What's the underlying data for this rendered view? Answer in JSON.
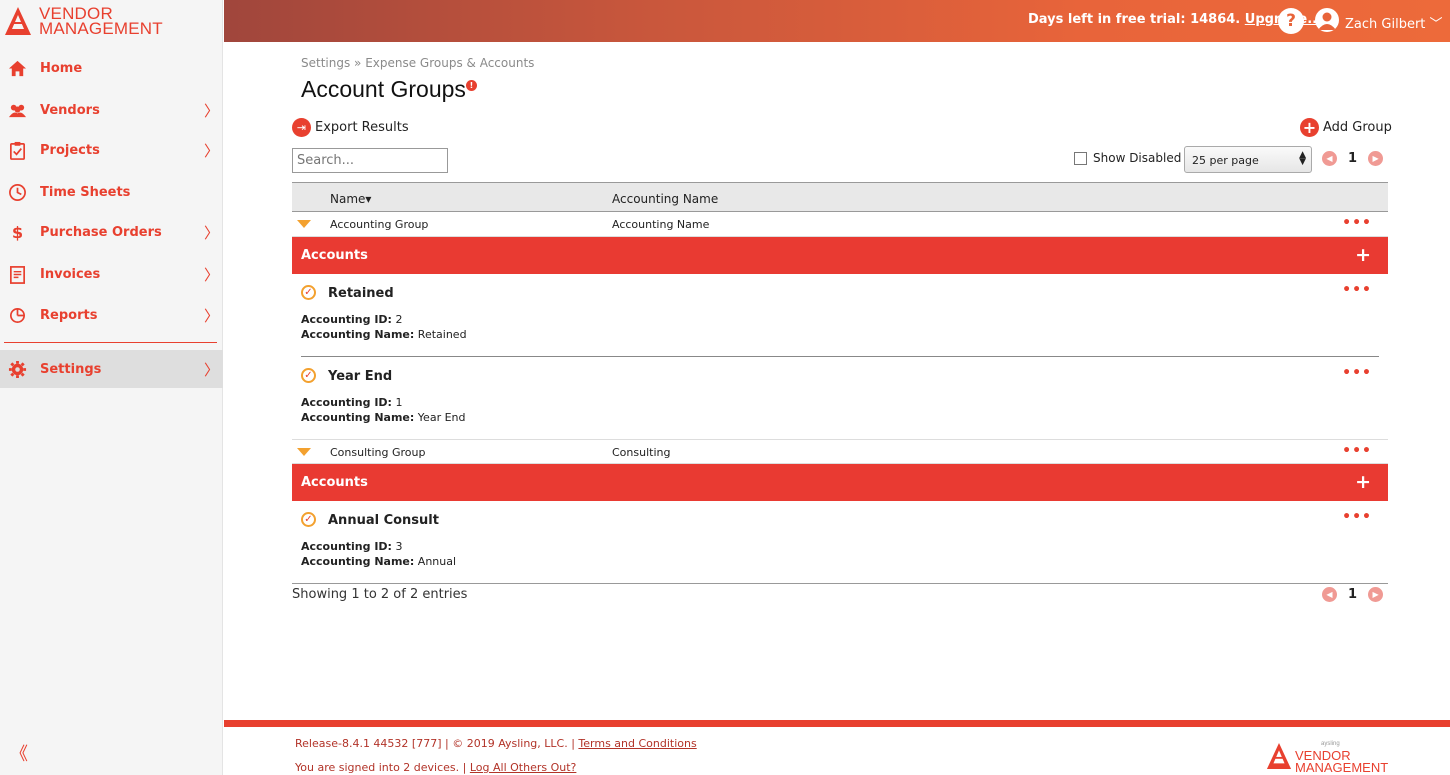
{
  "app": {
    "logo_line1": "VENDOR",
    "logo_line2": "MANAGEMENT"
  },
  "sidebar": {
    "items": [
      {
        "label": "Home",
        "chevron": ""
      },
      {
        "label": "Vendors",
        "chevron": "〉"
      },
      {
        "label": "Projects",
        "chevron": "〉"
      },
      {
        "label": "Time Sheets",
        "chevron": ""
      },
      {
        "label": "Purchase Orders",
        "chevron": "〉"
      },
      {
        "label": "Invoices",
        "chevron": "〉"
      },
      {
        "label": "Reports",
        "chevron": "〉"
      },
      {
        "label": "Settings",
        "chevron": "〉"
      }
    ],
    "collapse_glyph": "《"
  },
  "topbar": {
    "trial_text": "Days left in free trial: 14864.",
    "upgrade_label": "Upgrade...",
    "help_glyph": "?",
    "user_name": "Zach Gilbert",
    "user_chevron": "﹀"
  },
  "page": {
    "breadcrumb": "Settings  »  Expense Groups & Accounts",
    "title": "Account Groups",
    "title_info_glyph": "!",
    "export_label": "Export Results",
    "add_group_label": "Add Group",
    "search_placeholder": "Search...",
    "show_disabled_label": "Show Disabled",
    "per_page_value": "25 per page",
    "current_page": "1"
  },
  "table": {
    "headers": {
      "name": "Name▾",
      "accounting_name": "Accounting Name"
    },
    "groups": [
      {
        "name": "Accounting Group",
        "accounting_name": "Accounting Name",
        "accounts_label": "Accounts",
        "accounts": [
          {
            "name": "Retained",
            "id_label": "Accounting ID:",
            "id": "2",
            "name_label": "Accounting Name:",
            "acc_name": "Retained"
          },
          {
            "name": "Year End",
            "id_label": "Accounting ID:",
            "id": "1",
            "name_label": "Accounting Name:",
            "acc_name": "Year End"
          }
        ]
      },
      {
        "name": "Consulting Group",
        "accounting_name": "Consulting",
        "accounts_label": "Accounts",
        "accounts": [
          {
            "name": "Annual Consult",
            "id_label": "Accounting ID:",
            "id": "3",
            "name_label": "Accounting Name:",
            "acc_name": "Annual"
          }
        ]
      }
    ],
    "showing_text": "Showing 1 to 2 of 2 entries"
  },
  "footer": {
    "release_text": "Release-8.4.1 44532 [777] | © 2019 Aysling, LLC. |",
    "terms_label": "Terms and Conditions",
    "signed_in_text": "You are signed into 2 devices. |",
    "logout_label": "Log All Others Out?",
    "logo_small": "aysling",
    "logo_line1": "VENDOR",
    "logo_line2": "MANAGEMENT"
  },
  "colors": {
    "accent": "#e8402f",
    "accounts_bar": "#e93a32",
    "expand_triangle": "#f3a12f"
  }
}
